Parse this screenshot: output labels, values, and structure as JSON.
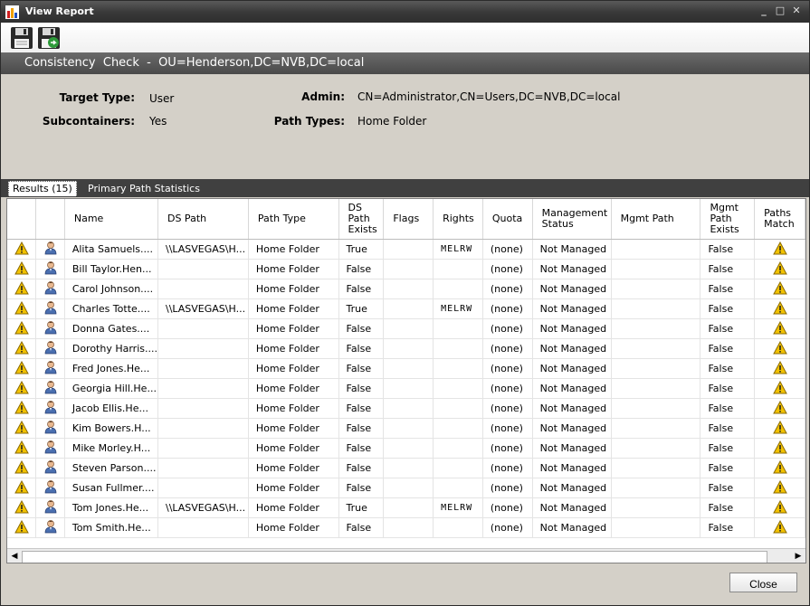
{
  "window": {
    "title": "View Report"
  },
  "toolbar": {
    "save_icon": "save-icon",
    "save_as_icon": "save-export-icon"
  },
  "header": {
    "title": "Consistency  Check  -  OU=Henderson,DC=NVB,DC=local"
  },
  "info": {
    "target_type_label": "Target Type:",
    "target_type_value": "User",
    "subcontainers_label": "Subcontainers:",
    "subcontainers_value": "Yes",
    "admin_label": "Admin:",
    "admin_value": "CN=Administrator,CN=Users,DC=NVB,DC=local",
    "path_types_label": "Path Types:",
    "path_types_value": "Home Folder"
  },
  "tabs": {
    "results": "Results  (15)",
    "stats": "Primary Path Statistics"
  },
  "columns": [
    {
      "key": "status",
      "label": ""
    },
    {
      "key": "type",
      "label": ""
    },
    {
      "key": "name",
      "label": "Name"
    },
    {
      "key": "ds_path",
      "label": "DS Path"
    },
    {
      "key": "path_type",
      "label": "Path Type"
    },
    {
      "key": "ds_exists",
      "label": "DS Path Exists"
    },
    {
      "key": "flags",
      "label": "Flags"
    },
    {
      "key": "rights",
      "label": "Rights"
    },
    {
      "key": "quota",
      "label": "Quota"
    },
    {
      "key": "mgmt_status",
      "label": "Management Status"
    },
    {
      "key": "mgmt_path",
      "label": "Mgmt Path"
    },
    {
      "key": "mgmt_exists",
      "label": "Mgmt Path Exists"
    },
    {
      "key": "paths_match",
      "label": "Paths Match"
    }
  ],
  "rows": [
    {
      "name": "Alita Samuels....",
      "ds_path": "\\\\LASVEGAS\\H...",
      "path_type": "Home Folder",
      "ds_exists": "True",
      "flags": "",
      "rights": "MELRW",
      "quota": "(none)",
      "mgmt_status": "Not Managed",
      "mgmt_path": "",
      "mgmt_exists": "False"
    },
    {
      "name": "Bill Taylor.Hen...",
      "ds_path": "",
      "path_type": "Home Folder",
      "ds_exists": "False",
      "flags": "",
      "rights": "",
      "quota": "(none)",
      "mgmt_status": "Not Managed",
      "mgmt_path": "",
      "mgmt_exists": "False"
    },
    {
      "name": "Carol Johnson....",
      "ds_path": "",
      "path_type": "Home Folder",
      "ds_exists": "False",
      "flags": "",
      "rights": "",
      "quota": "(none)",
      "mgmt_status": "Not Managed",
      "mgmt_path": "",
      "mgmt_exists": "False"
    },
    {
      "name": "Charles Totte....",
      "ds_path": "\\\\LASVEGAS\\H...",
      "path_type": "Home Folder",
      "ds_exists": "True",
      "flags": "",
      "rights": "MELRW",
      "quota": "(none)",
      "mgmt_status": "Not Managed",
      "mgmt_path": "",
      "mgmt_exists": "False"
    },
    {
      "name": "Donna Gates....",
      "ds_path": "",
      "path_type": "Home Folder",
      "ds_exists": "False",
      "flags": "",
      "rights": "",
      "quota": "(none)",
      "mgmt_status": "Not Managed",
      "mgmt_path": "",
      "mgmt_exists": "False"
    },
    {
      "name": "Dorothy Harris....",
      "ds_path": "",
      "path_type": "Home Folder",
      "ds_exists": "False",
      "flags": "",
      "rights": "",
      "quota": "(none)",
      "mgmt_status": "Not Managed",
      "mgmt_path": "",
      "mgmt_exists": "False"
    },
    {
      "name": "Fred Jones.He...",
      "ds_path": "",
      "path_type": "Home Folder",
      "ds_exists": "False",
      "flags": "",
      "rights": "",
      "quota": "(none)",
      "mgmt_status": "Not Managed",
      "mgmt_path": "",
      "mgmt_exists": "False"
    },
    {
      "name": "Georgia Hill.He...",
      "ds_path": "",
      "path_type": "Home Folder",
      "ds_exists": "False",
      "flags": "",
      "rights": "",
      "quota": "(none)",
      "mgmt_status": "Not Managed",
      "mgmt_path": "",
      "mgmt_exists": "False"
    },
    {
      "name": "Jacob Ellis.He...",
      "ds_path": "",
      "path_type": "Home Folder",
      "ds_exists": "False",
      "flags": "",
      "rights": "",
      "quota": "(none)",
      "mgmt_status": "Not Managed",
      "mgmt_path": "",
      "mgmt_exists": "False"
    },
    {
      "name": "Kim Bowers.H...",
      "ds_path": "",
      "path_type": "Home Folder",
      "ds_exists": "False",
      "flags": "",
      "rights": "",
      "quota": "(none)",
      "mgmt_status": "Not Managed",
      "mgmt_path": "",
      "mgmt_exists": "False"
    },
    {
      "name": "Mike Morley.H...",
      "ds_path": "",
      "path_type": "Home Folder",
      "ds_exists": "False",
      "flags": "",
      "rights": "",
      "quota": "(none)",
      "mgmt_status": "Not Managed",
      "mgmt_path": "",
      "mgmt_exists": "False"
    },
    {
      "name": "Steven Parson....",
      "ds_path": "",
      "path_type": "Home Folder",
      "ds_exists": "False",
      "flags": "",
      "rights": "",
      "quota": "(none)",
      "mgmt_status": "Not Managed",
      "mgmt_path": "",
      "mgmt_exists": "False"
    },
    {
      "name": "Susan Fullmer....",
      "ds_path": "",
      "path_type": "Home Folder",
      "ds_exists": "False",
      "flags": "",
      "rights": "",
      "quota": "(none)",
      "mgmt_status": "Not Managed",
      "mgmt_path": "",
      "mgmt_exists": "False"
    },
    {
      "name": "Tom Jones.He...",
      "ds_path": "\\\\LASVEGAS\\H...",
      "path_type": "Home Folder",
      "ds_exists": "True",
      "flags": "",
      "rights": "MELRW",
      "quota": "(none)",
      "mgmt_status": "Not Managed",
      "mgmt_path": "",
      "mgmt_exists": "False"
    },
    {
      "name": "Tom Smith.He...",
      "ds_path": "",
      "path_type": "Home Folder",
      "ds_exists": "False",
      "flags": "",
      "rights": "",
      "quota": "(none)",
      "mgmt_status": "Not Managed",
      "mgmt_path": "",
      "mgmt_exists": "False"
    }
  ],
  "row_icons": {
    "status": "warning-icon",
    "type": "user-icon",
    "paths_match": "warning-icon"
  },
  "colors": {
    "warning": "#f2c200",
    "title_bar": "#3a3a3a",
    "header_band": "#555555"
  },
  "footer": {
    "close_label": "Close"
  }
}
